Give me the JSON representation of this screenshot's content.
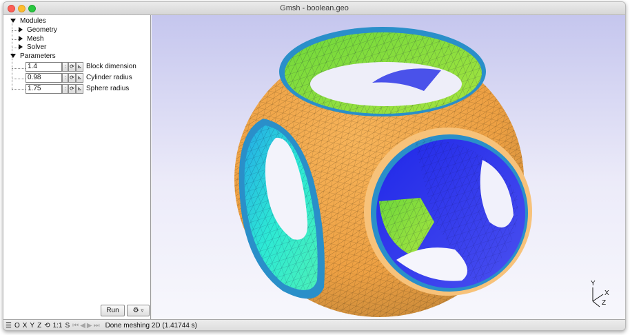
{
  "window": {
    "title": "Gmsh - boolean.geo"
  },
  "tree": {
    "modules": "Modules",
    "geometry": "Geometry",
    "mesh": "Mesh",
    "solver": "Solver",
    "parameters": "Parameters"
  },
  "params": [
    {
      "value": "1.4",
      "label": "Block dimension"
    },
    {
      "value": "0.98",
      "label": "Cylinder radius"
    },
    {
      "value": "1.75",
      "label": "Sphere radius"
    }
  ],
  "buttons": {
    "run": "Run",
    "options_icon": "gear-icon"
  },
  "status": {
    "items": [
      "O",
      "X",
      "Y",
      "Z",
      "1:1",
      "S"
    ],
    "message": "Done meshing 2D (1.41744 s)"
  },
  "axes": {
    "y": "Y",
    "x": "X",
    "z": "Z"
  },
  "colors": {
    "orange": "#f2a448",
    "green": "#8edd3a",
    "cyan": "#2fe7d6",
    "blue": "#2d36e8",
    "rim": "#2a8fc9"
  }
}
